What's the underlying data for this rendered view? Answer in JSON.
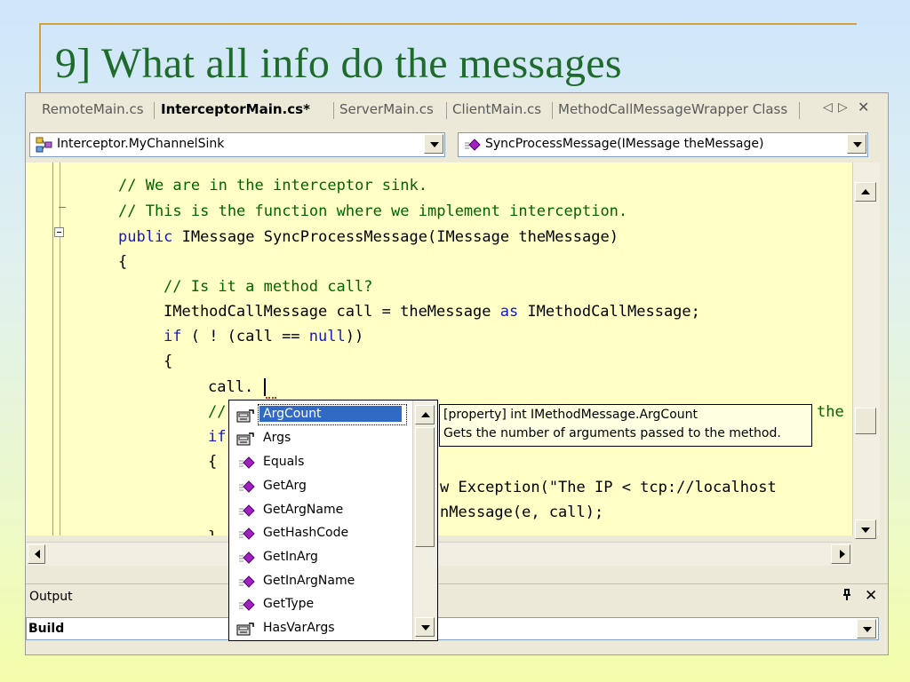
{
  "slide": {
    "title": "9] What all info do the messages"
  },
  "tabs": [
    {
      "label": "RemoteMain.cs",
      "active": false
    },
    {
      "label": "InterceptorMain.cs*",
      "active": true
    },
    {
      "label": "ServerMain.cs",
      "active": false
    },
    {
      "label": "ClientMain.cs",
      "active": false
    },
    {
      "label": "MethodCallMessageWrapper Class",
      "active": false
    }
  ],
  "tab_controls": {
    "prev": "◁",
    "next": "▷",
    "close": "✕"
  },
  "class_combo": {
    "value": "Interceptor.MyChannelSink",
    "icon": "class-icon"
  },
  "member_combo": {
    "value": "SyncProcessMessage(IMessage theMessage)",
    "icon": "method-icon"
  },
  "code": {
    "line1": "// We are in the interceptor sink.",
    "line2": "// This is the function where we implement interception.",
    "line3_kw": "public",
    "line3_rest": " IMessage SyncProcessMessage(IMessage theMessage)",
    "line4": "{",
    "line5": "// Is it a method call?",
    "line6_a": "IMethodCallMessage call = theMessage ",
    "line6_kw": "as",
    "line6_b": " IMethodCallMessage;",
    "line7_kw": "if",
    "line7_a": " ( ! (call == ",
    "line7_kw2": "null",
    "line7_b": "))",
    "line8": "{",
    "line9": "call.",
    "line10_a": "//",
    "line10_b": "the",
    "line11": "if",
    "line12": "{",
    "line13": "w Exception(\"The IP < tcp://localhost",
    "line14": "nMessage(e, call);",
    "line15": "}"
  },
  "intellisense": {
    "items": [
      {
        "label": "ArgCount",
        "kind": "property",
        "selected": true
      },
      {
        "label": "Args",
        "kind": "property",
        "selected": false
      },
      {
        "label": "Equals",
        "kind": "method",
        "selected": false
      },
      {
        "label": "GetArg",
        "kind": "method",
        "selected": false
      },
      {
        "label": "GetArgName",
        "kind": "method",
        "selected": false
      },
      {
        "label": "GetHashCode",
        "kind": "method",
        "selected": false
      },
      {
        "label": "GetInArg",
        "kind": "method",
        "selected": false
      },
      {
        "label": "GetInArgName",
        "kind": "method",
        "selected": false
      },
      {
        "label": "GetType",
        "kind": "method",
        "selected": false
      },
      {
        "label": "HasVarArgs",
        "kind": "property",
        "selected": false
      }
    ]
  },
  "tooltip": {
    "line1": "[property] int IMethodMessage.ArgCount",
    "line2": "Gets the number of arguments passed to the method."
  },
  "output_panel": {
    "label": "Output",
    "pin": "ᵖ",
    "close": "✕",
    "build_value": "Build"
  }
}
